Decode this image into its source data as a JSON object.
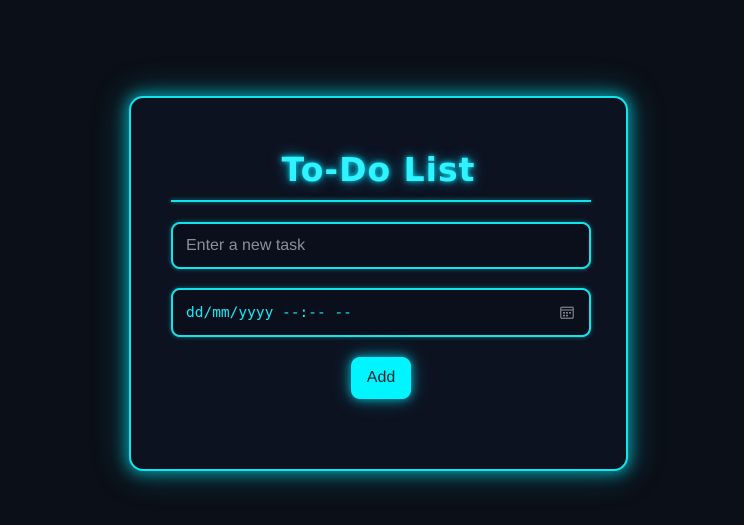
{
  "app": {
    "title": "To-Do List"
  },
  "form": {
    "task_placeholder": "Enter a new task",
    "task_value": "",
    "datetime_display": "dd/mm/yyyy --:-- --",
    "add_label": "Add"
  },
  "icons": {
    "datetime_picker": "calendar-icon"
  },
  "colors": {
    "accent": "#00f5ff",
    "border": "#12e4ec",
    "background": "#0b0f17",
    "card": "#0d1220"
  }
}
